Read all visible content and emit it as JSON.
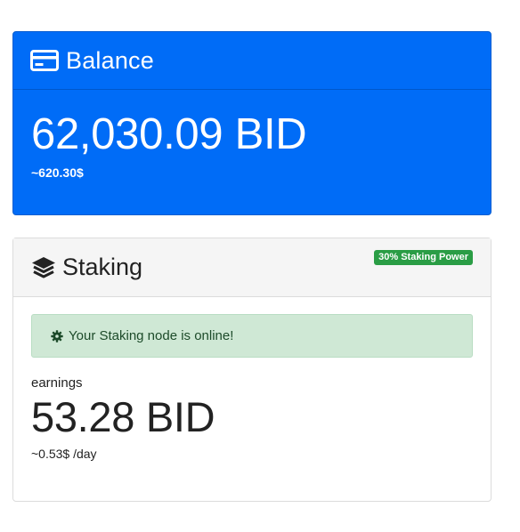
{
  "balance": {
    "icon": "credit-card-icon",
    "title": "Balance",
    "amount": "62,030.09 BID",
    "usd": "~620.30$"
  },
  "staking": {
    "icon": "layers-icon",
    "title": "Staking",
    "badge": "30% Staking Power",
    "status_icon": "gear-icon",
    "status_text": "Your Staking node is online!",
    "earnings_label": "earnings",
    "earnings_amount": "53.28 BID",
    "earnings_rate": "~0.53$ /day"
  },
  "colors": {
    "balance_bg": "#006cf7",
    "badge_bg": "#2a9d45",
    "alert_bg": "#cfe8d5"
  }
}
